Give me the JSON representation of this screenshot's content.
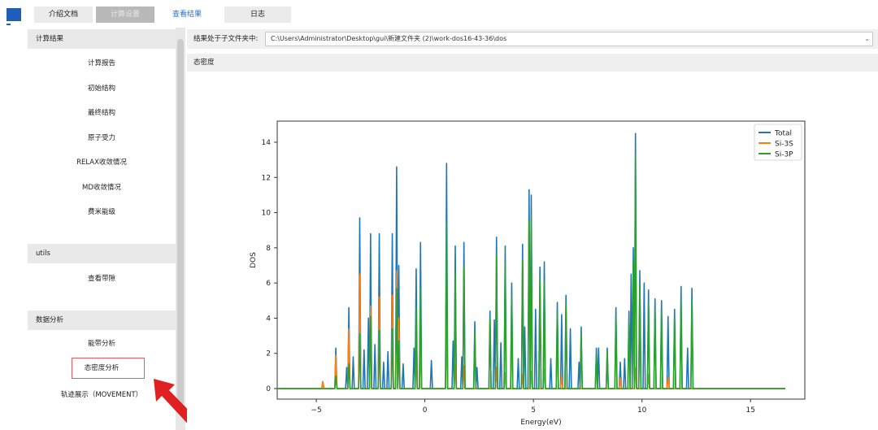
{
  "tabs": [
    {
      "label": "介绍文档",
      "state": "normal"
    },
    {
      "label": "计算设置",
      "state": "disabled"
    },
    {
      "label": "查看结果",
      "state": "active"
    },
    {
      "label": "日志",
      "state": "normal"
    }
  ],
  "sidebar": {
    "sections": [
      {
        "title": "计算结果",
        "items": [
          "计算报告",
          "初始结构",
          "最终结构",
          "原子受力",
          "RELAX收敛情况",
          "MD收敛情况",
          "费米能级"
        ]
      },
      {
        "title": "utils",
        "items": [
          "查看带隙"
        ]
      },
      {
        "title": "数据分析",
        "items": [
          "能带分析",
          "态密度分析",
          "轨迹展示（MOVEMENT）"
        ]
      }
    ],
    "selected_item": "态密度分析"
  },
  "main": {
    "path_label": "结果处于子文件夹中:",
    "path_value": "C:\\Users\\Administrator\\Desktop\\gui\\新建文件夹 (2)\\work-dos16-43-36\\dos",
    "panel_title": "态密度"
  },
  "colors": {
    "accent": "#2a6fd6",
    "highlight": "#e35b5b",
    "arrow": "#e02020",
    "total": "#1f77b4",
    "si3s": "#ff7f0e",
    "si3p": "#2ca02c"
  },
  "chart_data": {
    "type": "line",
    "xlabel": "Energy(eV)",
    "ylabel": "DOS",
    "xlim": [
      -6.8,
      17.5
    ],
    "ylim": [
      -0.6,
      15.2
    ],
    "xticks": [
      -5,
      0,
      5,
      10,
      15
    ],
    "yticks": [
      0,
      2,
      4,
      6,
      8,
      10,
      12,
      14
    ],
    "legend_position": "top-right",
    "grid": false,
    "series": [
      {
        "name": "Total",
        "color": "#1f77b4",
        "peaks": [
          [
            -4.7,
            0.4
          ],
          [
            -4.1,
            2.3
          ],
          [
            -3.6,
            1.2
          ],
          [
            -3.5,
            4.6
          ],
          [
            -3.3,
            1.8
          ],
          [
            -3.0,
            9.7
          ],
          [
            -2.8,
            2.2
          ],
          [
            -2.6,
            4.0
          ],
          [
            -2.5,
            8.8
          ],
          [
            -2.3,
            2.5
          ],
          [
            -2.1,
            8.8
          ],
          [
            -1.9,
            1.5
          ],
          [
            -1.7,
            2.1
          ],
          [
            -1.5,
            8.8
          ],
          [
            -1.3,
            12.6
          ],
          [
            -1.2,
            7.0
          ],
          [
            -1.0,
            1.4
          ],
          [
            -0.5,
            2.3
          ],
          [
            -0.4,
            6.8
          ],
          [
            -0.2,
            8.3
          ],
          [
            0.3,
            1.6
          ],
          [
            1.0,
            12.8
          ],
          [
            1.3,
            2.7
          ],
          [
            1.4,
            8.1
          ],
          [
            1.7,
            1.8
          ],
          [
            1.8,
            8.3
          ],
          [
            2.3,
            3.8
          ],
          [
            2.4,
            1.2
          ],
          [
            3.0,
            4.4
          ],
          [
            3.2,
            3.9
          ],
          [
            3.3,
            8.6
          ],
          [
            3.5,
            2.6
          ],
          [
            3.7,
            8.1
          ],
          [
            4.0,
            6.0
          ],
          [
            4.3,
            1.7
          ],
          [
            4.5,
            8.2
          ],
          [
            4.6,
            3.5
          ],
          [
            4.8,
            11.3
          ],
          [
            4.9,
            11.0
          ],
          [
            5.1,
            4.5
          ],
          [
            5.3,
            6.9
          ],
          [
            5.5,
            7.2
          ],
          [
            5.8,
            1.7
          ],
          [
            6.1,
            4.9
          ],
          [
            6.3,
            4.2
          ],
          [
            6.5,
            5.3
          ],
          [
            6.7,
            3.4
          ],
          [
            7.1,
            1.5
          ],
          [
            7.2,
            3.5
          ],
          [
            7.9,
            2.3
          ],
          [
            8.0,
            2.3
          ],
          [
            8.4,
            2.3
          ],
          [
            8.8,
            4.6
          ],
          [
            9.0,
            1.5
          ],
          [
            9.2,
            1.7
          ],
          [
            9.4,
            4.4
          ],
          [
            9.5,
            6.5
          ],
          [
            9.6,
            8.0
          ],
          [
            9.7,
            14.5
          ],
          [
            9.9,
            6.7
          ],
          [
            10.1,
            6.0
          ],
          [
            10.3,
            5.6
          ],
          [
            10.6,
            5.1
          ],
          [
            10.9,
            5.0
          ],
          [
            11.2,
            4.1
          ],
          [
            11.5,
            4.5
          ],
          [
            11.8,
            5.8
          ],
          [
            12.1,
            2.3
          ],
          [
            12.3,
            5.7
          ]
        ]
      },
      {
        "name": "Si-3S",
        "color": "#ff7f0e",
        "peaks": [
          [
            -4.7,
            0.4
          ],
          [
            -4.1,
            1.9
          ],
          [
            -3.5,
            3.4
          ],
          [
            -3.0,
            6.5
          ],
          [
            -2.5,
            4.7
          ],
          [
            -2.1,
            5.2
          ],
          [
            -1.5,
            5.3
          ],
          [
            -1.3,
            6.7
          ],
          [
            -1.2,
            4.0
          ],
          [
            -0.4,
            2.1
          ],
          [
            -0.2,
            2.5
          ],
          [
            1.0,
            3.3
          ],
          [
            1.4,
            1.4
          ],
          [
            1.8,
            1.3
          ],
          [
            3.3,
            1.2
          ],
          [
            3.7,
            0.9
          ],
          [
            4.5,
            0.8
          ],
          [
            4.9,
            1.0
          ],
          [
            5.5,
            1.1
          ],
          [
            6.3,
            0.7
          ],
          [
            9.0,
            0.6
          ],
          [
            9.7,
            1.2
          ],
          [
            10.3,
            0.8
          ],
          [
            11.2,
            0.7
          ]
        ]
      },
      {
        "name": "Si-3P",
        "color": "#2ca02c",
        "peaks": [
          [
            -4.1,
            0.7
          ],
          [
            -3.5,
            1.4
          ],
          [
            -3.0,
            3.1
          ],
          [
            -2.5,
            4.1
          ],
          [
            -2.1,
            3.3
          ],
          [
            -1.5,
            3.4
          ],
          [
            -1.3,
            5.7
          ],
          [
            -1.2,
            2.7
          ],
          [
            -0.4,
            4.6
          ],
          [
            -0.2,
            5.7
          ],
          [
            1.0,
            9.4
          ],
          [
            1.4,
            6.6
          ],
          [
            1.8,
            6.9
          ],
          [
            2.3,
            3.3
          ],
          [
            3.0,
            4.0
          ],
          [
            3.3,
            7.6
          ],
          [
            3.7,
            7.2
          ],
          [
            4.0,
            5.3
          ],
          [
            4.5,
            7.3
          ],
          [
            4.8,
            9.5
          ],
          [
            4.9,
            9.8
          ],
          [
            5.3,
            6.2
          ],
          [
            5.5,
            6.1
          ],
          [
            6.1,
            4.4
          ],
          [
            6.5,
            4.8
          ],
          [
            7.2,
            3.1
          ],
          [
            7.9,
            2.0
          ],
          [
            8.4,
            2.1
          ],
          [
            8.8,
            4.1
          ],
          [
            9.4,
            3.9
          ],
          [
            9.6,
            7.2
          ],
          [
            9.7,
            13.3
          ],
          [
            9.9,
            6.0
          ],
          [
            10.3,
            4.9
          ],
          [
            10.6,
            4.5
          ],
          [
            10.9,
            4.4
          ],
          [
            11.5,
            4.0
          ],
          [
            11.8,
            5.0
          ],
          [
            12.3,
            5.0
          ]
        ]
      }
    ]
  }
}
